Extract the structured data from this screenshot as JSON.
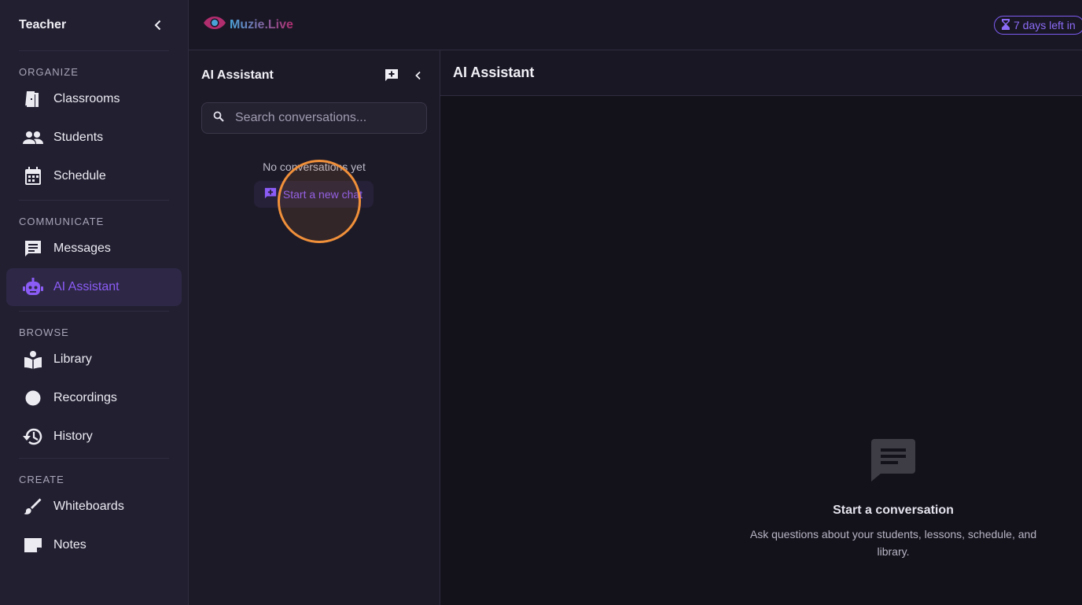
{
  "sidebar": {
    "title": "Teacher",
    "sections": [
      {
        "label": "ORGANIZE",
        "items": [
          {
            "label": "Classrooms",
            "icon": "door-icon"
          },
          {
            "label": "Students",
            "icon": "people-icon"
          },
          {
            "label": "Schedule",
            "icon": "calendar-icon"
          }
        ]
      },
      {
        "label": "COMMUNICATE",
        "items": [
          {
            "label": "Messages",
            "icon": "chat-icon"
          },
          {
            "label": "AI Assistant",
            "icon": "robot-icon",
            "active": true
          }
        ]
      },
      {
        "label": "BROWSE",
        "items": [
          {
            "label": "Library",
            "icon": "book-icon"
          },
          {
            "label": "Recordings",
            "icon": "record-icon"
          },
          {
            "label": "History",
            "icon": "history-icon"
          }
        ]
      },
      {
        "label": "CREATE",
        "items": [
          {
            "label": "Whiteboards",
            "icon": "brush-icon"
          },
          {
            "label": "Notes",
            "icon": "note-icon"
          }
        ]
      }
    ]
  },
  "header": {
    "logo_text": "Muzie.Live",
    "trial_text": "7 days left in"
  },
  "conversations": {
    "title": "AI Assistant",
    "search_placeholder": "Search conversations...",
    "empty_text": "No conversations yet",
    "new_chat_label": "Start a new chat"
  },
  "main": {
    "title": "AI Assistant",
    "empty_title": "Start a conversation",
    "empty_subtitle": "Ask questions about your students, lessons, schedule, and library."
  },
  "colors": {
    "accent": "#8b5cf6",
    "sidebar_bg": "#221f31",
    "cursor_ring": "#f0903a"
  }
}
